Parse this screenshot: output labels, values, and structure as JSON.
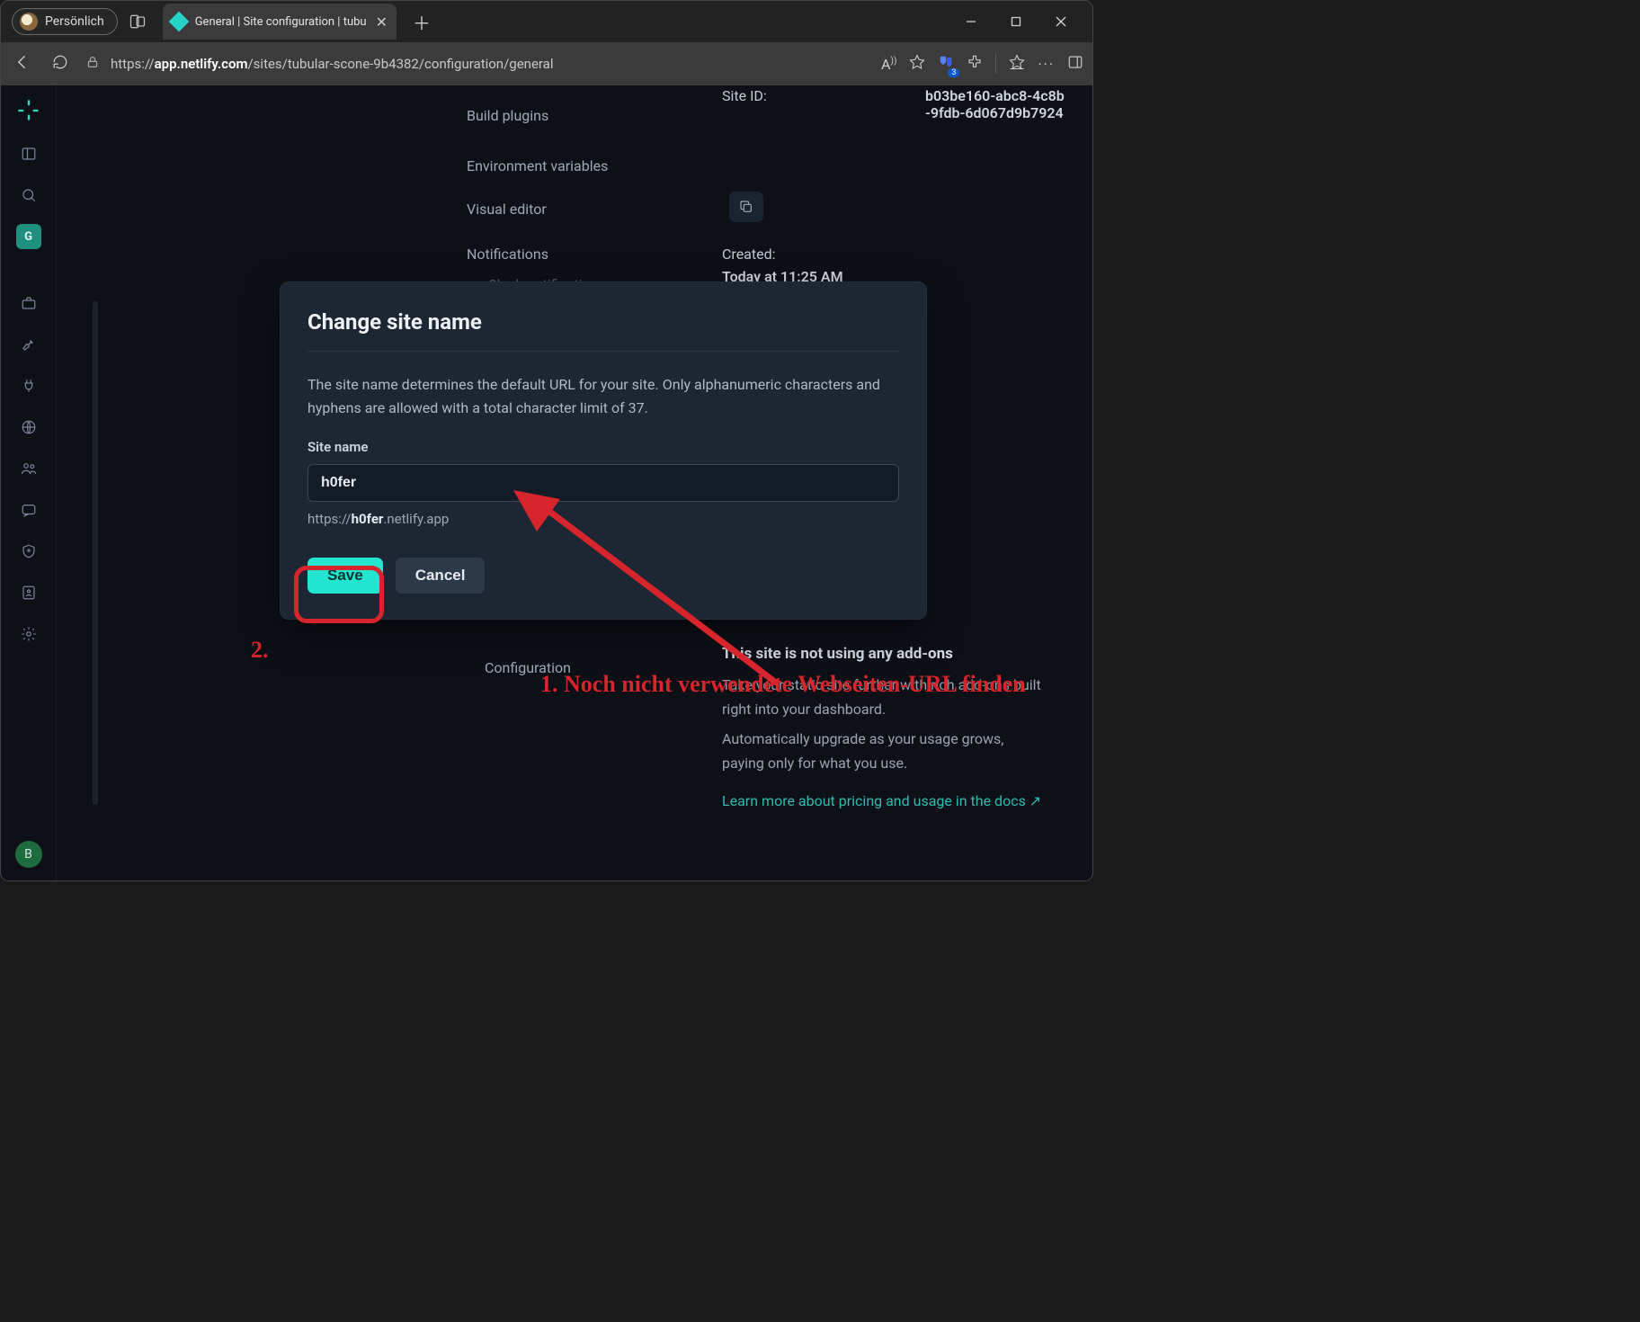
{
  "browser": {
    "profile_tab": "Persönlich",
    "active_tab": {
      "title": "General | Site configuration | tubu",
      "favicon_color": "#27d3c6"
    },
    "url_display": {
      "prefix": "https://",
      "host": "app.netlify.com",
      "path": "/sites/tubular-scone-9b4382/configuration/general"
    },
    "extension_badge": "3"
  },
  "sidebar": {
    "active_letter": "G",
    "footer_letter": "B"
  },
  "page": {
    "nav_links": {
      "build_plugins": "Build plugins",
      "env_vars": "Environment variables",
      "visual_editor": "Visual editor",
      "notifications": "Notifications",
      "slack": "Slack notifications",
      "configuration": "Configuration"
    },
    "site_id": {
      "label": "Site ID:",
      "value": "b03be160-abc8-4c8b-9fdb-6d067d9b7924"
    },
    "created": {
      "label": "Created:",
      "value": "Today at 11:25 AM"
    },
    "addons": {
      "title": "This site is not using any add-ons",
      "line1": "Take your static site further with rich add-ons built right into your dashboard.",
      "line2": "Automatically upgrade as your usage grows, paying only for what you use.",
      "link": "Learn more about pricing and usage in the docs  ↗"
    }
  },
  "modal": {
    "title": "Change site name",
    "description": "The site name determines the default URL for your site. Only alphanumeric characters and hyphens are allowed with a total character limit of 37.",
    "field_label": "Site name",
    "input_value": "h0fer",
    "preview_prefix": "https://",
    "preview_slug": "h0fer",
    "preview_suffix": ".netlify.app",
    "save": "Save",
    "cancel": "Cancel"
  },
  "annotations": {
    "step1": "1. Noch nicht verwendete Webseiten-URL finden",
    "step2": "2."
  }
}
